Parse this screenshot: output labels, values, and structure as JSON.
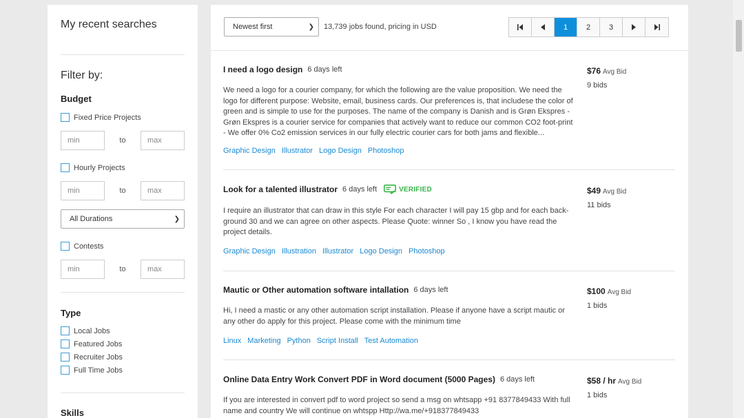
{
  "sidebar": {
    "recent_title": "My recent searches",
    "filter_by": "Filter by:",
    "budget": {
      "heading": "Budget",
      "fixed_label": "Fixed Price Projects",
      "hourly_label": "Hourly Projects",
      "contests_label": "Contests",
      "min_placeholder": "min",
      "max_placeholder": "max",
      "to": "to",
      "duration_selected": "All Durations"
    },
    "type": {
      "heading": "Type",
      "options": [
        "Local Jobs",
        "Featured Jobs",
        "Recruiter Jobs",
        "Full Time Jobs"
      ]
    },
    "skills_heading": "Skills"
  },
  "toolbar": {
    "sort_selected": "Newest first",
    "found_text": "13,739 jobs found, pricing in USD",
    "pager": {
      "first_icon": "first-page-icon",
      "prev_icon": "prev-page-icon",
      "pages": [
        "1",
        "2",
        "3"
      ],
      "current": "1",
      "next_icon": "next-page-icon",
      "last_icon": "last-page-icon"
    }
  },
  "jobs": [
    {
      "title": "I need a logo design",
      "days_left": "6 days left",
      "verified": false,
      "description": "We need a logo for a courier company, for which the following are the value proposition. We need the logo for different purpose: Website, email, business cards. Our preferences is, that includese the color of green and is simple to use for the purposes. The name of the company is Danish and is Grøn Ekspres - Grøn Ekspres is a courier service for companies that actively want to reduce our common CO2 foot-print - We offer 0% Co2 emission services in our fully electric courier cars for both jams and flexible...",
      "tags": [
        "Graphic Design",
        "Illustrator",
        "Logo Design",
        "Photoshop"
      ],
      "bid": "$76",
      "bid_label": "Avg Bid",
      "bids": "9 bids"
    },
    {
      "title": "Look for a talented illustrator",
      "days_left": "6 days left",
      "verified": true,
      "verified_label": "VERIFIED",
      "description": "I require an illustrator that can draw in this style For each character I will pay 15 gbp and for each back-ground 30 and we can agree on other aspects. Please Quote: winner So , I know you have read the project details.",
      "tags": [
        "Graphic Design",
        "Illustration",
        "Illustrator",
        "Logo Design",
        "Photoshop"
      ],
      "bid": "$49",
      "bid_label": "Avg Bid",
      "bids": "11 bids"
    },
    {
      "title": "Mautic or Other automation software intallation",
      "days_left": "6 days left",
      "verified": false,
      "description": "Hi, I need a mastic or any other automation script installation. Please if anyone have a script mautic or any other do apply for this project. Please come with the minimum time",
      "tags": [
        "Linux",
        "Marketing",
        "Python",
        "Script Install",
        "Test Automation"
      ],
      "bid": "$100",
      "bid_label": "Avg Bid",
      "bids": "1 bids"
    },
    {
      "title": "Online Data Entry Work Convert PDF in Word document (5000 Pages)",
      "days_left": "6 days left",
      "verified": false,
      "description": "If you are interested in convert pdf to word project so send a msg on whtsapp +91 8377849433 With full name and country We will continue on whtspp Http://wa.me/+918377849433",
      "tags": [],
      "bid": "$58 / hr",
      "bid_label": "Avg Bid",
      "bids": "1 bids"
    }
  ]
}
